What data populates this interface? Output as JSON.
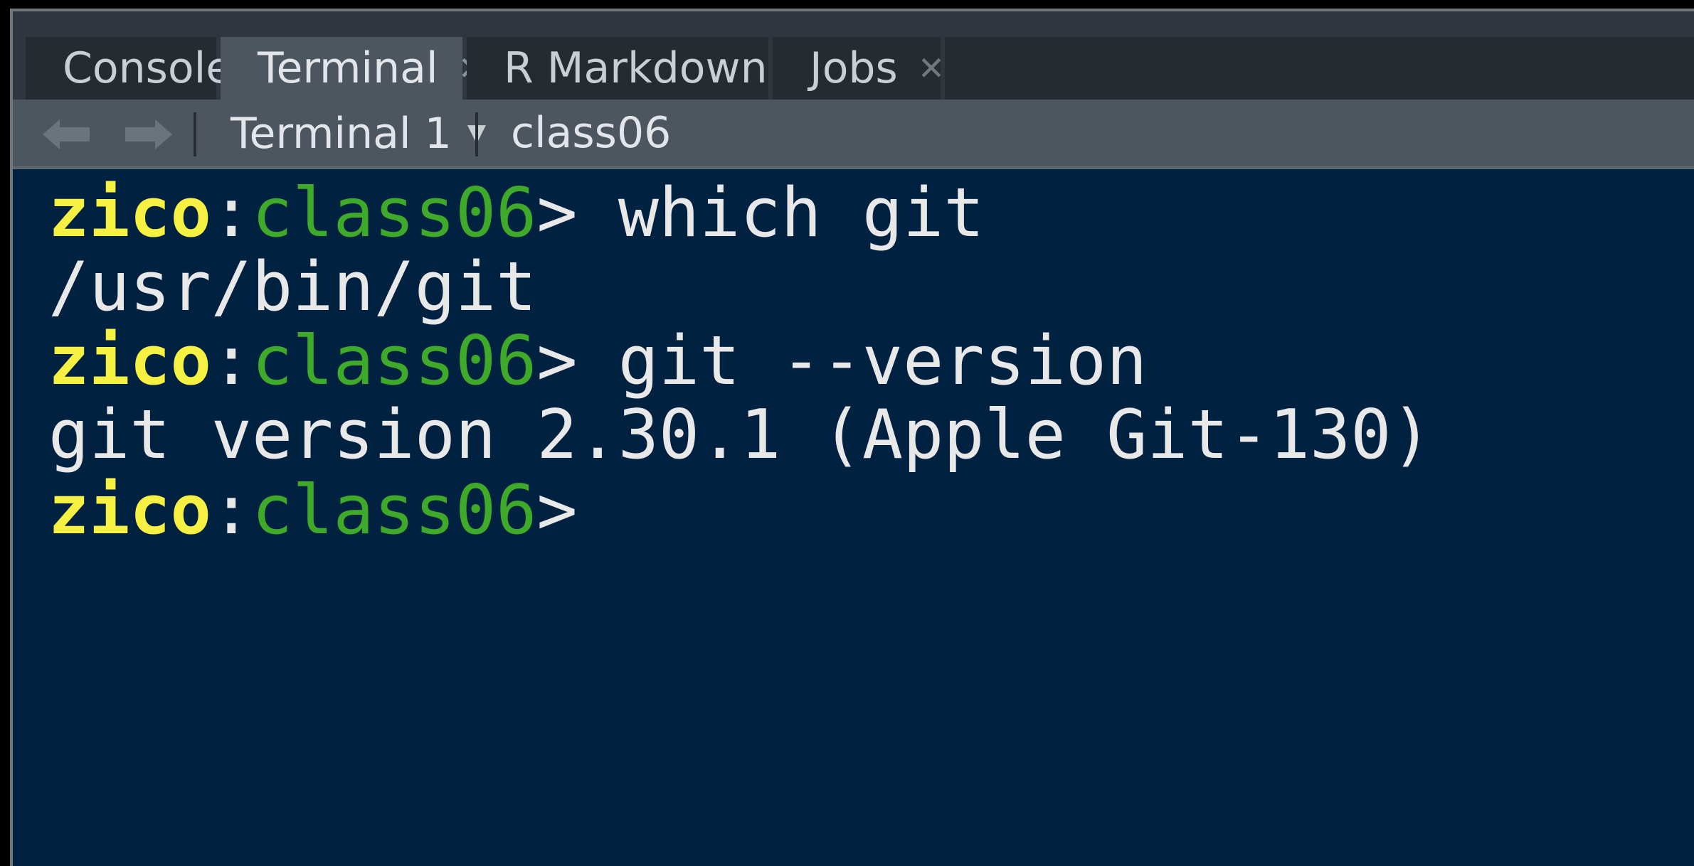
{
  "tabs": [
    {
      "label": "Console",
      "closable": false,
      "active": false
    },
    {
      "label": "Terminal",
      "closable": true,
      "active": true
    },
    {
      "label": "R Markdown",
      "closable": true,
      "active": false
    },
    {
      "label": "Jobs",
      "closable": true,
      "active": false
    }
  ],
  "toolbar": {
    "back_icon": "arrow-left-icon",
    "forward_icon": "arrow-right-icon",
    "terminal_select": "Terminal 1",
    "cwd": "class06"
  },
  "terminal": {
    "lines": [
      {
        "type": "prompt",
        "user": "zico",
        "sep": ":",
        "path": "class06",
        "gt": ">",
        "command": " which git"
      },
      {
        "type": "output",
        "text": "/usr/bin/git"
      },
      {
        "type": "prompt",
        "user": "zico",
        "sep": ":",
        "path": "class06",
        "gt": ">",
        "command": " git --version"
      },
      {
        "type": "output",
        "text": "git version 2.30.1 (Apple Git-130)"
      },
      {
        "type": "prompt",
        "user": "zico",
        "sep": ":",
        "path": "class06",
        "gt": ">",
        "command": ""
      }
    ]
  },
  "colors": {
    "terminal_bg": "#00213f",
    "prompt_user": "#f5f042",
    "prompt_path": "#3fa92a",
    "text": "#e8e8e8"
  }
}
